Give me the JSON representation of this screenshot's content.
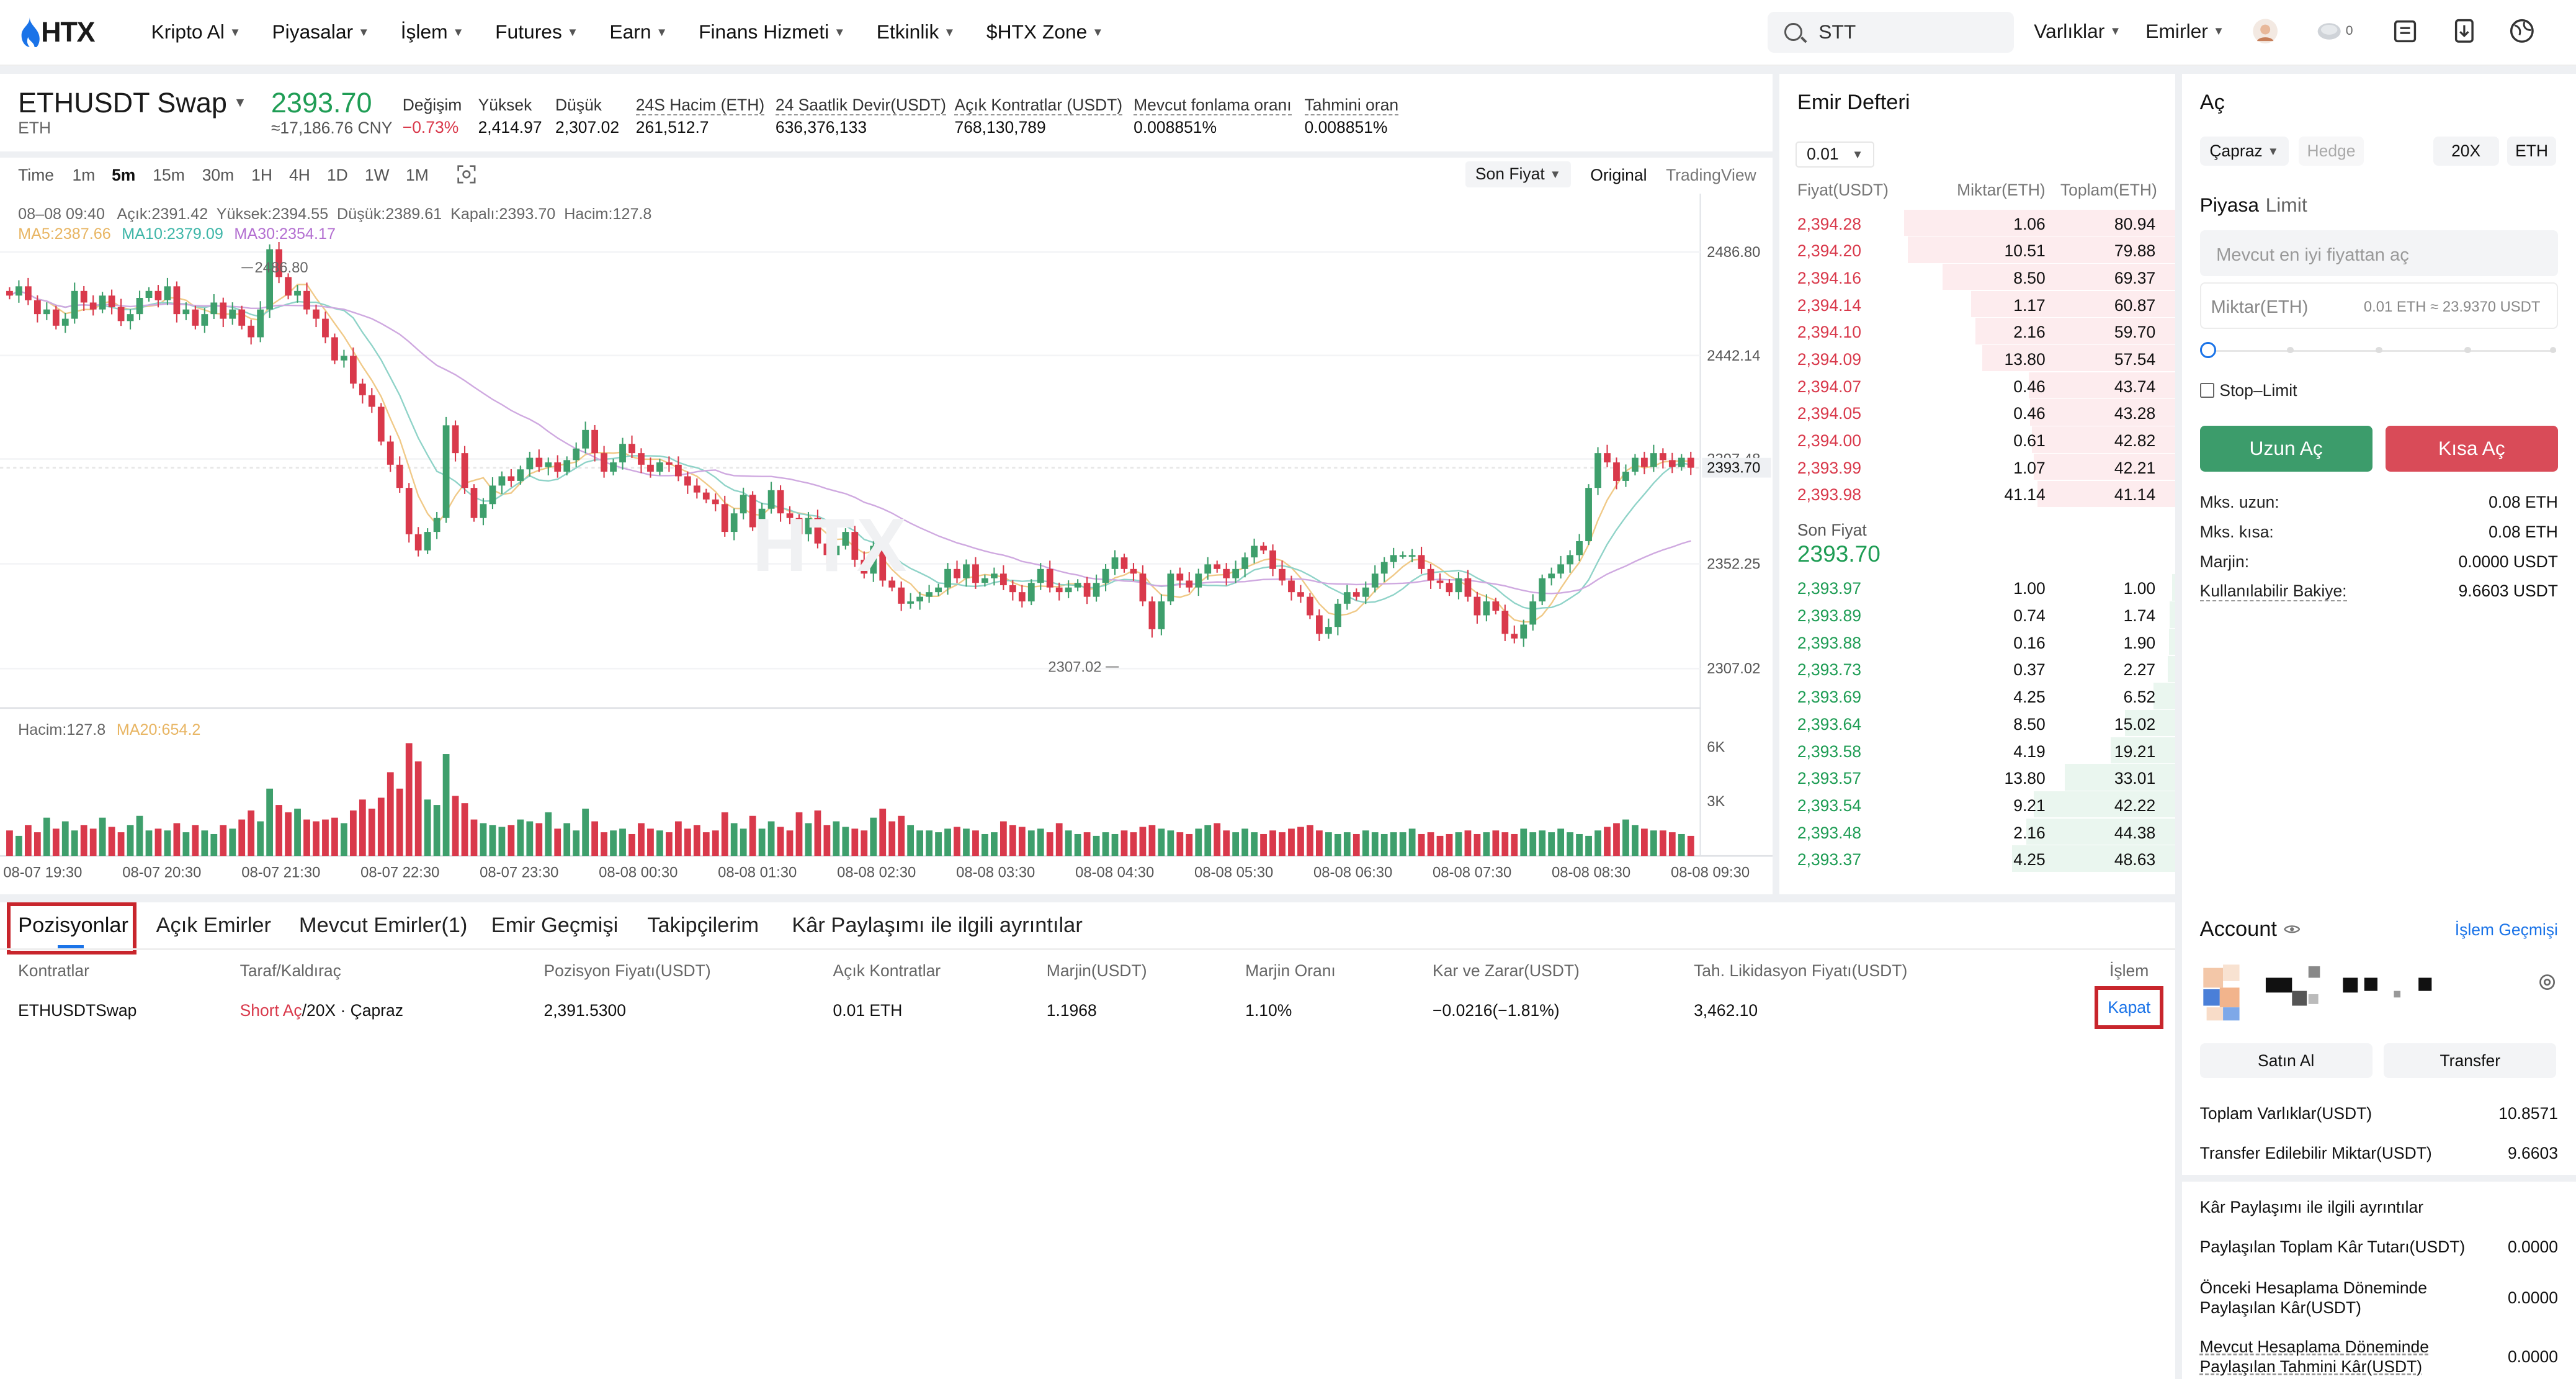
{
  "nav": {
    "logo_text": "HTX",
    "items": [
      "Kripto Al",
      "Piyasalar",
      "İşlem",
      "Futures",
      "Earn",
      "Finans Hizmeti",
      "Etkinlik",
      "$HTX Zone"
    ],
    "search_value": "STT",
    "right_items": [
      "Varlıklar",
      "Emirler"
    ],
    "badge_count": "0"
  },
  "ticker": {
    "symbol": "ETHUSDT Swap",
    "base": "ETH",
    "last_price": "2393.70",
    "cny": "≈17,186.76 CNY",
    "stats": [
      {
        "label": "Değişim",
        "value": "−0.73%"
      },
      {
        "label": "Yüksek",
        "value": "2,414.97"
      },
      {
        "label": "Düşük",
        "value": "2,307.02"
      },
      {
        "label": "24S Hacim (ETH)",
        "value": "261,512.7"
      },
      {
        "label": "24 Saatlik Devir(USDT)",
        "value": "636,376,133"
      },
      {
        "label": "Açık Kontratlar (USDT)",
        "value": "768,130,789"
      },
      {
        "label": "Mevcut fonlama oranı",
        "value": "0.008851%"
      },
      {
        "label": "Tahmini oran",
        "value": "0.008851%"
      }
    ]
  },
  "chart_toolbar": {
    "timeframes": [
      "Time",
      "1m",
      "5m",
      "15m",
      "30m",
      "1H",
      "4H",
      "1D",
      "1W",
      "1M"
    ],
    "active": "5m",
    "price_type": "Son Fiyat",
    "view_original": "Original",
    "view_tv": "TradingView"
  },
  "chart_info": {
    "ohlc": "08–08 09:40   Açık:2391.42  Yüksek:2394.55  Düşük:2389.61  Kapalı:2393.70  Hacim:127.8",
    "ma5": "MA5:2387.66",
    "ma10": "MA10:2379.09",
    "ma30": "MA30:2354.17",
    "high_marker": "2486.80",
    "low_marker": "2307.02",
    "volume_label": "Hacim:127.8",
    "volume_ma": "MA20:654.2",
    "watermark": "HTX"
  },
  "chart_data": {
    "type": "candlestick",
    "x_ticks": [
      "08-07 19:30",
      "08-07 20:30",
      "08-07 21:30",
      "08-07 22:30",
      "08-07 23:30",
      "08-08 00:30",
      "08-08 01:30",
      "08-08 02:30",
      "08-08 03:30",
      "08-08 04:30",
      "08-08 05:30",
      "08-08 06:30",
      "08-08 07:30",
      "08-08 08:30",
      "08-08 09:30"
    ],
    "y_ticks": [
      "2486.80",
      "2442.14",
      "2397.48",
      "2352.25",
      "2307.02"
    ],
    "ylim": [
      2290,
      2512
    ],
    "current_price_label": "2393.70",
    "volume_ticks": [
      "6K",
      "3K"
    ],
    "volume_ylim": [
      0,
      7500
    ],
    "close": [
      2468,
      2472,
      2466,
      2460,
      2462,
      2455,
      2458,
      2470,
      2465,
      2462,
      2468,
      2463,
      2457,
      2460,
      2467,
      2470,
      2466,
      2472,
      2460,
      2462,
      2455,
      2460,
      2465,
      2458,
      2462,
      2455,
      2450,
      2462,
      2488,
      2476,
      2468,
      2470,
      2462,
      2458,
      2450,
      2440,
      2442,
      2430,
      2425,
      2420,
      2405,
      2395,
      2385,
      2365,
      2358,
      2366,
      2372,
      2412,
      2400,
      2385,
      2372,
      2378,
      2386,
      2390,
      2388,
      2393,
      2398,
      2394,
      2396,
      2392,
      2397,
      2402,
      2410,
      2400,
      2392,
      2396,
      2404,
      2400,
      2395,
      2392,
      2396,
      2395,
      2390,
      2386,
      2383,
      2380,
      2378,
      2366,
      2374,
      2382,
      2368,
      2376,
      2384,
      2374,
      2372,
      2365,
      2372,
      2361,
      2356,
      2360,
      2366,
      2354,
      2348,
      2360,
      2345,
      2342,
      2335,
      2336,
      2338,
      2340,
      2342,
      2350,
      2346,
      2352,
      2344,
      2346,
      2348,
      2343,
      2340,
      2336,
      2344,
      2350,
      2342,
      2340,
      2342,
      2344,
      2338,
      2344,
      2350,
      2355,
      2350,
      2348,
      2336,
      2324,
      2336,
      2348,
      2345,
      2342,
      2348,
      2352,
      2350,
      2346,
      2350,
      2355,
      2360,
      2358,
      2350,
      2345,
      2340,
      2338,
      2330,
      2322,
      2325,
      2335,
      2340,
      2338,
      2342,
      2348,
      2353,
      2356,
      2356,
      2356,
      2350,
      2345,
      2344,
      2340,
      2346,
      2338,
      2330,
      2336,
      2332,
      2322,
      2320,
      2326,
      2336,
      2346,
      2348,
      2352,
      2356,
      2362,
      2385,
      2400,
      2396,
      2388,
      2392,
      2398,
      2394,
      2400,
      2397,
      2394,
      2398,
      2393.7
    ],
    "volume": [
      1400,
      1100,
      1700,
      1300,
      2100,
      1500,
      1900,
      1400,
      1700,
      1500,
      2100,
      1600,
      1300,
      1700,
      2200,
      1400,
      1500,
      1400,
      1800,
      1300,
      1700,
      1400,
      1200,
      1700,
      1500,
      2000,
      2500,
      1900,
      3700,
      2800,
      2400,
      2600,
      2000,
      1900,
      2000,
      2100,
      1800,
      2500,
      3100,
      2600,
      3200,
      4600,
      3700,
      6200,
      5200,
      3100,
      2800,
      5600,
      3300,
      2900,
      2000,
      1800,
      1700,
      1600,
      1700,
      2000,
      1900,
      1800,
      2400,
      1500,
      1800,
      1400,
      2600,
      1900,
      1300,
      1400,
      1500,
      1200,
      1800,
      1500,
      1400,
      1300,
      1900,
      1500,
      1700,
      1300,
      1400,
      2400,
      1800,
      1500,
      2200,
      1500,
      1900,
      1600,
      1400,
      2400,
      1800,
      2500,
      1700,
      1900,
      1600,
      1500,
      1400,
      2100,
      2600,
      1900,
      2200,
      1700,
      1400,
      1400,
      1300,
      1500,
      1600,
      1500,
      1400,
      1200,
      1300,
      1900,
      1700,
      1600,
      1400,
      1500,
      1300,
      1800,
      1400,
      1200,
      1300,
      1100,
      1300,
      1200,
      1400,
      1300,
      1600,
      1700,
      1500,
      1400,
      1300,
      1200,
      1500,
      1700,
      1800,
      1400,
      1300,
      1500,
      1300,
      1200,
      1400,
      1300,
      1500,
      1600,
      1700,
      1400,
      1300,
      1200,
      1300,
      1200,
      1400,
      1300,
      1200,
      1300,
      1300,
      1500,
      1200,
      1300,
      1100,
      1200,
      1300,
      1400,
      1200,
      1300,
      1400,
      1300,
      1200,
      1500,
      1300,
      1400,
      1300,
      1500,
      1300,
      1200,
      1100,
      1400,
      1600,
      1800,
      2000,
      1700,
      1500,
      1400,
      1400,
      1300,
      1200,
      1100,
      1000,
      700
    ]
  },
  "orderbook": {
    "title": "Emir Defteri",
    "precision": "0.01",
    "col_price": "Fiyat(USDT)",
    "col_amount": "Miktar(ETH)",
    "col_total": "Toplam(ETH)",
    "asks": [
      [
        "2,394.28",
        "1.06",
        "80.94"
      ],
      [
        "2,394.20",
        "10.51",
        "79.88"
      ],
      [
        "2,394.16",
        "8.50",
        "69.37"
      ],
      [
        "2,394.14",
        "1.17",
        "60.87"
      ],
      [
        "2,394.10",
        "2.16",
        "59.70"
      ],
      [
        "2,394.09",
        "13.80",
        "57.54"
      ],
      [
        "2,394.07",
        "0.46",
        "43.74"
      ],
      [
        "2,394.05",
        "0.46",
        "43.28"
      ],
      [
        "2,394.00",
        "0.61",
        "42.82"
      ],
      [
        "2,393.99",
        "1.07",
        "42.21"
      ],
      [
        "2,393.98",
        "41.14",
        "41.14"
      ]
    ],
    "last_label": "Son Fiyat",
    "last_price": "2393.70",
    "bids": [
      [
        "2,393.97",
        "1.00",
        "1.00"
      ],
      [
        "2,393.89",
        "0.74",
        "1.74"
      ],
      [
        "2,393.88",
        "0.16",
        "1.90"
      ],
      [
        "2,393.73",
        "0.37",
        "2.27"
      ],
      [
        "2,393.69",
        "4.25",
        "6.52"
      ],
      [
        "2,393.64",
        "8.50",
        "15.02"
      ],
      [
        "2,393.58",
        "4.19",
        "19.21"
      ],
      [
        "2,393.57",
        "13.80",
        "33.01"
      ],
      [
        "2,393.54",
        "9.21",
        "42.22"
      ],
      [
        "2,393.48",
        "2.16",
        "44.38"
      ],
      [
        "2,393.37",
        "4.25",
        "48.63"
      ]
    ]
  },
  "trade": {
    "title": "Aç",
    "margin_mode": "Çapraz",
    "hedge": "Hedge",
    "leverage": "20X",
    "unit": "ETH",
    "tab_market": "Piyasa",
    "tab_limit": "Limit",
    "price_placeholder": "Mevcut en iyi fiyattan aç",
    "amount_label": "Miktar(ETH)",
    "amount_hint": "0.01 ETH ≈ 23.9370 USDT",
    "stop_limit": "Stop–Limit",
    "buy_btn": "Uzun Aç",
    "sell_btn": "Kısa Aç",
    "info": [
      {
        "label": "Mks. uzun:",
        "value": "0.08 ETH"
      },
      {
        "label": "Mks. kısa:",
        "value": "0.08 ETH"
      },
      {
        "label": "Marjin:",
        "value": "0.0000 USDT"
      },
      {
        "label": "Kullanılabilir Bakiye:",
        "value": "9.6603 USDT"
      }
    ]
  },
  "positions": {
    "tabs": [
      "Pozisyonlar",
      "Açık Emirler",
      "Mevcut Emirler(1)",
      "Emir Geçmişi",
      "Takipçilerim",
      "Kâr Paylaşımı ile ilgili ayrıntılar"
    ],
    "columns": [
      "Kontratlar",
      "Taraf/Kaldıraç",
      "Pozisyon Fiyatı(USDT)",
      "Açık Kontratlar",
      "Marjin(USDT)",
      "Marjin Oranı",
      "Kar ve Zarar(USDT)",
      "Tah. Likidasyon Fiyatı(USDT)",
      "İşlem"
    ],
    "row": {
      "contract": "ETHUSDTSwap",
      "side": "Short Aç",
      "lev": "/20X · Çapraz",
      "entry": "2,391.5300",
      "size": "0.01 ETH",
      "margin": "1.1968",
      "margin_ratio": "1.10%",
      "pnl": "−0.0216(−1.81%)",
      "liq": "3,462.10",
      "action": "Kapat"
    }
  },
  "account": {
    "title": "Account",
    "history_link": "İşlem Geçmişi",
    "buy_btn": "Satın Al",
    "transfer_btn": "Transfer",
    "total_label": "Toplam Varlıklar(USDT)",
    "total_value": "10.8571",
    "transferable_label": "Transfer Edilebilir Miktar(USDT)",
    "transferable_value": "9.6603",
    "profit_share_title": "Kâr Paylaşımı ile ilgili ayrıntılar",
    "profit_rows": [
      {
        "label": "Paylaşılan Toplam Kâr Tutarı(USDT)",
        "value": "0.0000"
      },
      {
        "label": "Önceki Hesaplama Döneminde Paylaşılan Kâr(USDT)",
        "value": "0.0000"
      },
      {
        "label": "Mevcut Hesaplama Döneminde Paylaşılan Tahmini Kâr(USDT)",
        "value": "0.0000"
      }
    ]
  }
}
